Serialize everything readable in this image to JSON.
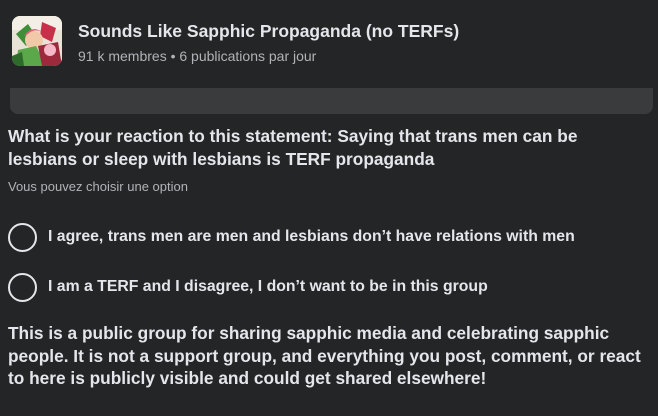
{
  "group": {
    "name": "Sounds Like Sapphic Propaganda (no TERFs)",
    "meta": "91 k membres • 6 publications par jour"
  },
  "poll": {
    "question": "What is your reaction to this statement: Saying that trans men can be lesbians or sleep with lesbians is TERF propaganda",
    "hint": "Vous pouvez choisir une option",
    "options": [
      {
        "label": "I agree, trans men are men and lesbians don’t have relations with men"
      },
      {
        "label": "I am a TERF and I disagree, I don’t want to be in this group"
      }
    ]
  },
  "description": "This is a public group for sharing sapphic media and celebrating sapphic people. It is not a support group, and everything you post, comment, or react to here is publicly visible and could get shared elsewhere!",
  "colors": {
    "background": "#242526",
    "text_primary": "#e4e6eb",
    "text_secondary": "#b0b3b8",
    "bar": "#3a3b3c"
  },
  "icons": {
    "avatar": "group-avatar-illustration",
    "radio": "radio-unselected-icon"
  }
}
